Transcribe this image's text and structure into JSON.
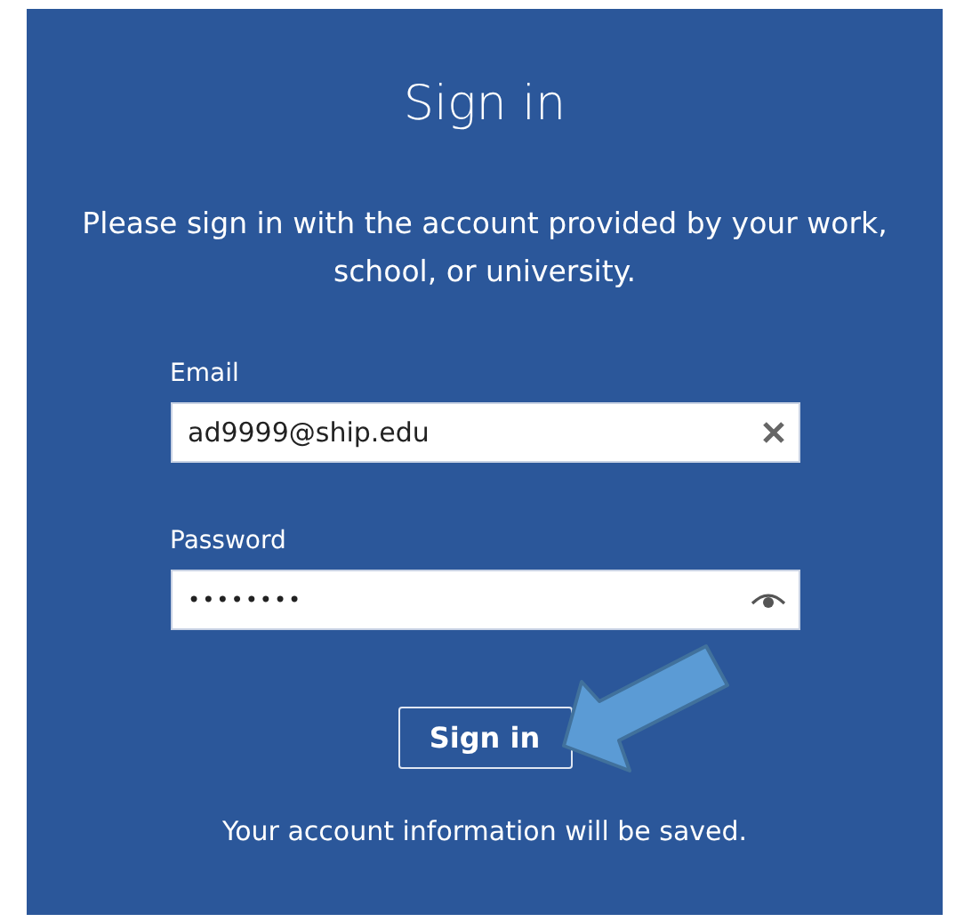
{
  "title": "Sign in",
  "instructions": "Please sign in with the account provided by your work, school, or university.",
  "email": {
    "label": "Email",
    "value": "ad9999@ship.edu"
  },
  "password": {
    "label": "Password",
    "value": "••••••••"
  },
  "submit": "Sign in",
  "note": "Your account information will be saved.",
  "annotation": {
    "kind": "arrow"
  }
}
